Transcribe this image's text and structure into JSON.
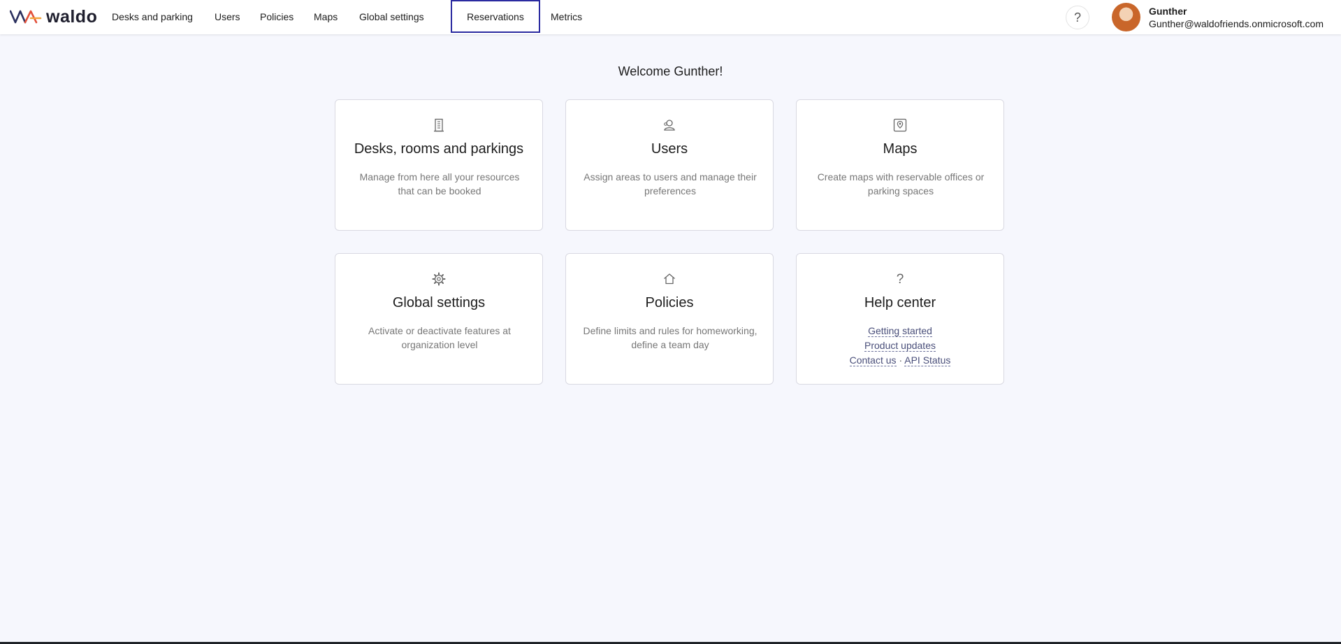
{
  "brand": {
    "name": "waldo"
  },
  "nav": {
    "items": [
      "Desks and parking",
      "Users",
      "Policies",
      "Maps",
      "Global settings"
    ],
    "selected": "Reservations",
    "metrics": "Metrics"
  },
  "header": {
    "help_symbol": "?",
    "user_name": "Gunther",
    "user_email": "Gunther@waldofriends.onmicrosoft.com"
  },
  "welcome": "Welcome Gunther!",
  "cards": [
    {
      "icon": "building-icon",
      "title": "Desks, rooms and parkings",
      "desc": "Manage from here all your resources that can be booked"
    },
    {
      "icon": "user-icon",
      "title": "Users",
      "desc": "Assign areas to users and manage their preferences"
    },
    {
      "icon": "map-icon",
      "title": "Maps",
      "desc": "Create maps with reservable offices or parking spaces"
    },
    {
      "icon": "gear-icon",
      "title": "Global settings",
      "desc": "Activate or deactivate features at organization level"
    },
    {
      "icon": "home-icon",
      "title": "Policies",
      "desc": "Define limits and rules for homeworking, define a team day"
    }
  ],
  "help_center": {
    "icon": "question-icon",
    "icon_symbol": "?",
    "title": "Help center",
    "links": {
      "getting_started": "Getting started",
      "product_updates": "Product updates",
      "contact_us": "Contact us",
      "separator": "·",
      "api_status": "API Status"
    }
  },
  "colors": {
    "background": "#f6f7fd",
    "selected_border": "#2a2aa0",
    "link": "#4a4f7a"
  }
}
